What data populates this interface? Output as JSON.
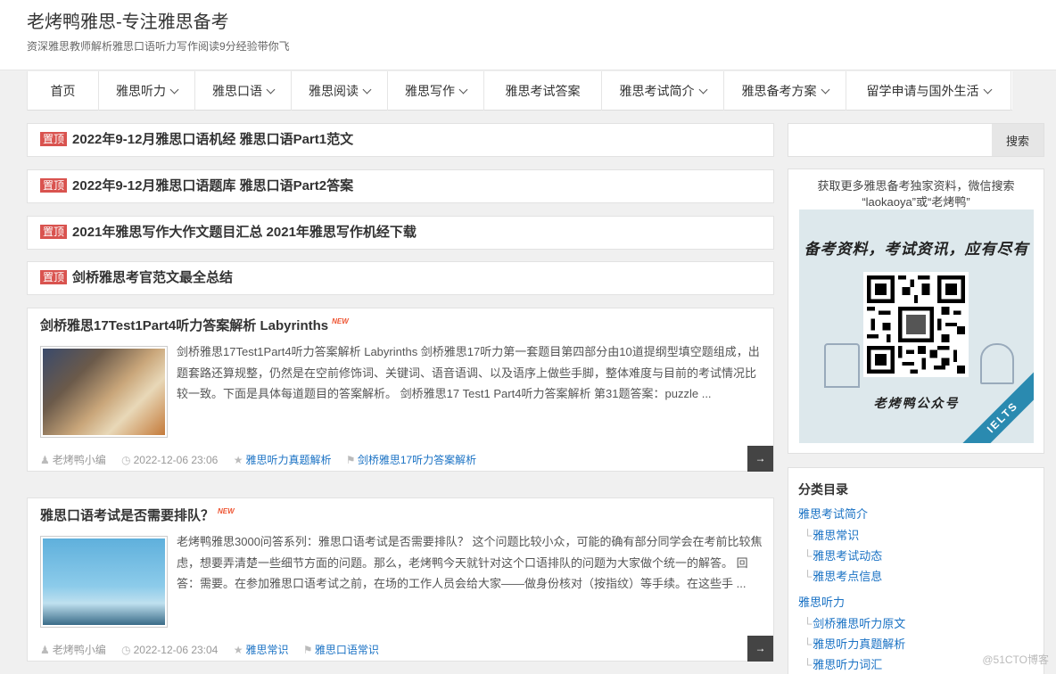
{
  "site": {
    "title": "老烤鸭雅思-专注雅思备考",
    "description": "资深雅思教师解析雅思口语听力写作阅读9分经验带你飞"
  },
  "nav": {
    "items": [
      {
        "label": "首页",
        "has_dropdown": false
      },
      {
        "label": "雅思听力",
        "has_dropdown": true
      },
      {
        "label": "雅思口语",
        "has_dropdown": true
      },
      {
        "label": "雅思阅读",
        "has_dropdown": true
      },
      {
        "label": "雅思写作",
        "has_dropdown": true
      },
      {
        "label": "雅思考试答案",
        "has_dropdown": false
      },
      {
        "label": "雅思考试简介",
        "has_dropdown": true
      },
      {
        "label": "雅思备考方案",
        "has_dropdown": true
      },
      {
        "label": "留学申请与国外生活",
        "has_dropdown": true
      }
    ]
  },
  "sticky_posts": {
    "badge": "置顶",
    "items": [
      {
        "title": "2022年9-12月雅思口语机经 雅思口语Part1范文"
      },
      {
        "title": "2022年9-12月雅思口语题库 雅思口语Part2答案"
      },
      {
        "title": "2021年雅思写作大作文题目汇总 2021年雅思写作机经下载"
      },
      {
        "title": "剑桥雅思考官范文最全总结"
      }
    ]
  },
  "posts": [
    {
      "title": "剑桥雅思17Test1Part4听力答案解析 Labyrinths",
      "new_badge": "NEW",
      "excerpt": "剑桥雅思17Test1Part4听力答案解析 Labyrinths 剑桥雅思17听力第一套题目第四部分由10道提纲型填空题组成，出题套路还算规整，仍然是在空前修饰词、关键词、语音语调、以及语序上做些手脚，整体难度与目前的考试情况比较一致。下面是具体每道题目的答案解析。 剑桥雅思17 Test1 Part4听力答案解析 第31题答案：puzzle ...",
      "author": "老烤鸭小编",
      "date": "2022-12-06 23:06",
      "category": "雅思听力真题解析",
      "tag": "剑桥雅思17听力答案解析",
      "arrow": "→"
    },
    {
      "title": "雅思口语考试是否需要排队？",
      "new_badge": "NEW",
      "excerpt": "老烤鸭雅思3000问答系列：雅思口语考试是否需要排队？ 这个问题比较小众，可能的确有部分同学会在考前比较焦虑，想要弄清楚一些细节方面的问题。那么，老烤鸭今天就针对这个口语排队的问题为大家做个统一的解答。 回答：需要。在参加雅思口语考试之前，在场的工作人员会给大家——做身份核对（按指纹）等手续。在这些手 ...",
      "author": "老烤鸭小编",
      "date": "2022-12-06 23:04",
      "category": "雅思常识",
      "tag": "雅思口语常识",
      "arrow": "→"
    }
  ],
  "sidebar": {
    "search": {
      "placeholder": "",
      "button": "搜索"
    },
    "qr_widget": {
      "text": "获取更多雅思备考独家资料，微信搜索 “laokaoya”或“老烤鸭”",
      "slogan": "备考资料，考试资讯，应有尽有",
      "name": "老烤鸭公众号",
      "ribbon": "IELTS"
    },
    "categories": {
      "title": "分类目录",
      "groups": [
        {
          "label": "雅思考试简介",
          "children": [
            "雅思常识",
            "雅思考试动态",
            "雅思考点信息"
          ]
        },
        {
          "label": "雅思听力",
          "children": [
            "剑桥雅思听力原文",
            "雅思听力真题解析",
            "雅思听力词汇"
          ]
        }
      ]
    }
  },
  "watermark": "@51CTO博客"
}
